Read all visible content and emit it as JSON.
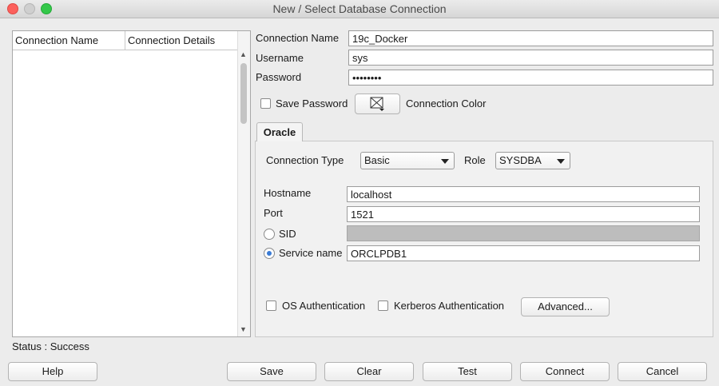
{
  "window": {
    "title": "New / Select Database Connection"
  },
  "connections_list": {
    "columns": [
      "Connection Name",
      "Connection Details"
    ]
  },
  "form": {
    "connection_name_label": "Connection Name",
    "connection_name_value": "19c_Docker",
    "username_label": "Username",
    "username_value": "sys",
    "password_label": "Password",
    "password_value": "••••••••",
    "save_password_label": "Save Password",
    "save_password_checked": false,
    "connection_color_label": "Connection Color"
  },
  "oracle_tab": {
    "tab_label": "Oracle",
    "connection_type_label": "Connection Type",
    "connection_type_value": "Basic",
    "role_label": "Role",
    "role_value": "SYSDBA",
    "hostname_label": "Hostname",
    "hostname_value": "localhost",
    "port_label": "Port",
    "port_value": "1521",
    "sid_label": "SID",
    "sid_value": "",
    "service_name_label": "Service name",
    "service_name_value": "ORCLPDB1",
    "selected_option": "Service name",
    "os_auth_label": "OS Authentication",
    "kerberos_auth_label": "Kerberos Authentication",
    "advanced_label": "Advanced..."
  },
  "status": {
    "text": "Status : Success"
  },
  "buttons": {
    "help": "Help",
    "save": "Save",
    "clear": "Clear",
    "test": "Test",
    "connect": "Connect",
    "cancel": "Cancel"
  },
  "colors": {
    "radio_selected": "#3a7bd5",
    "traffic_close": "#fc605c",
    "traffic_max": "#34c84a"
  }
}
